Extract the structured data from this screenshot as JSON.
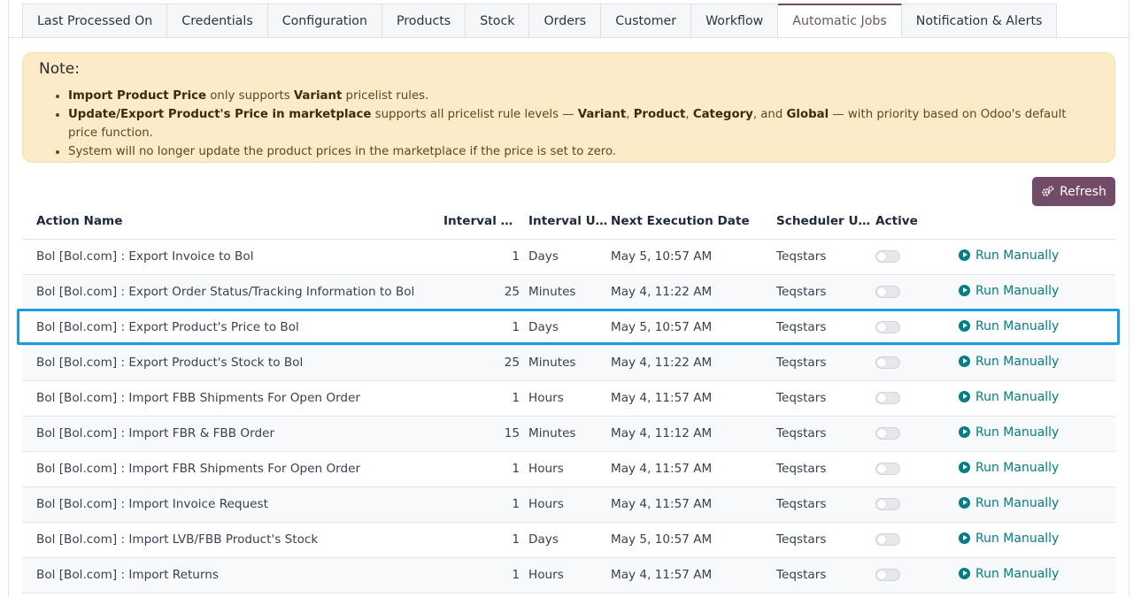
{
  "tabs": [
    {
      "label": "Last Processed On"
    },
    {
      "label": "Credentials"
    },
    {
      "label": "Configuration"
    },
    {
      "label": "Products"
    },
    {
      "label": "Stock"
    },
    {
      "label": "Orders"
    },
    {
      "label": "Customer"
    },
    {
      "label": "Workflow"
    },
    {
      "label": "Automatic Jobs",
      "active": true
    },
    {
      "label": "Notification & Alerts"
    }
  ],
  "note": {
    "title": "Note:",
    "line1": {
      "b1": "Import Product Price",
      "t1": " only supports ",
      "b2": "Variant",
      "t2": " pricelist rules."
    },
    "line2": {
      "b1": "Update/Export Product's Price in marketplace",
      "t1": " supports all pricelist rule levels — ",
      "b2": "Variant",
      "t2": ", ",
      "b3": "Product",
      "t3": ", ",
      "b4": "Category",
      "t4": ", and ",
      "b5": "Global",
      "t5": " — with priority based on Odoo's default price function."
    },
    "line3": "System will no longer update the product prices in the marketplace if the price is set to zero."
  },
  "refresh_label": "Refresh",
  "colors": {
    "primary": "#714b67",
    "accent": "#017e84",
    "highlight": "#1a9be0",
    "note_bg": "#fbebc9"
  },
  "table": {
    "headers": {
      "action": "Action Name",
      "interval": "Interval Number",
      "unit": "Interval Unit",
      "next": "Next Execution Date",
      "user": "Scheduler User",
      "active": "Active"
    },
    "run_label": "Run Manually",
    "rows": [
      {
        "action": "Bol [Bol.com] : Export Invoice to Bol",
        "interval": "1",
        "unit": "Days",
        "next": "May 5, 10:57 AM",
        "user": "Teqstars",
        "active": false
      },
      {
        "action": "Bol [Bol.com] : Export Order Status/Tracking Information to Bol",
        "interval": "25",
        "unit": "Minutes",
        "next": "May 4, 11:22 AM",
        "user": "Teqstars",
        "active": false
      },
      {
        "action": "Bol [Bol.com] : Export Product's Price to Bol",
        "interval": "1",
        "unit": "Days",
        "next": "May 5, 10:57 AM",
        "user": "Teqstars",
        "active": false,
        "highlighted": true
      },
      {
        "action": "Bol [Bol.com] : Export Product's Stock to Bol",
        "interval": "25",
        "unit": "Minutes",
        "next": "May 4, 11:22 AM",
        "user": "Teqstars",
        "active": false
      },
      {
        "action": "Bol [Bol.com] : Import FBB Shipments For Open Order",
        "interval": "1",
        "unit": "Hours",
        "next": "May 4, 11:57 AM",
        "user": "Teqstars",
        "active": false
      },
      {
        "action": "Bol [Bol.com] : Import FBR & FBB Order",
        "interval": "15",
        "unit": "Minutes",
        "next": "May 4, 11:12 AM",
        "user": "Teqstars",
        "active": false
      },
      {
        "action": "Bol [Bol.com] : Import FBR Shipments For Open Order",
        "interval": "1",
        "unit": "Hours",
        "next": "May 4, 11:57 AM",
        "user": "Teqstars",
        "active": false
      },
      {
        "action": "Bol [Bol.com] : Import Invoice Request",
        "interval": "1",
        "unit": "Hours",
        "next": "May 4, 11:57 AM",
        "user": "Teqstars",
        "active": false
      },
      {
        "action": "Bol [Bol.com] : Import LVB/FBB Product's Stock",
        "interval": "1",
        "unit": "Days",
        "next": "May 5, 10:57 AM",
        "user": "Teqstars",
        "active": false
      },
      {
        "action": "Bol [Bol.com] : Import Returns",
        "interval": "1",
        "unit": "Hours",
        "next": "May 4, 11:57 AM",
        "user": "Teqstars",
        "active": false
      }
    ]
  }
}
